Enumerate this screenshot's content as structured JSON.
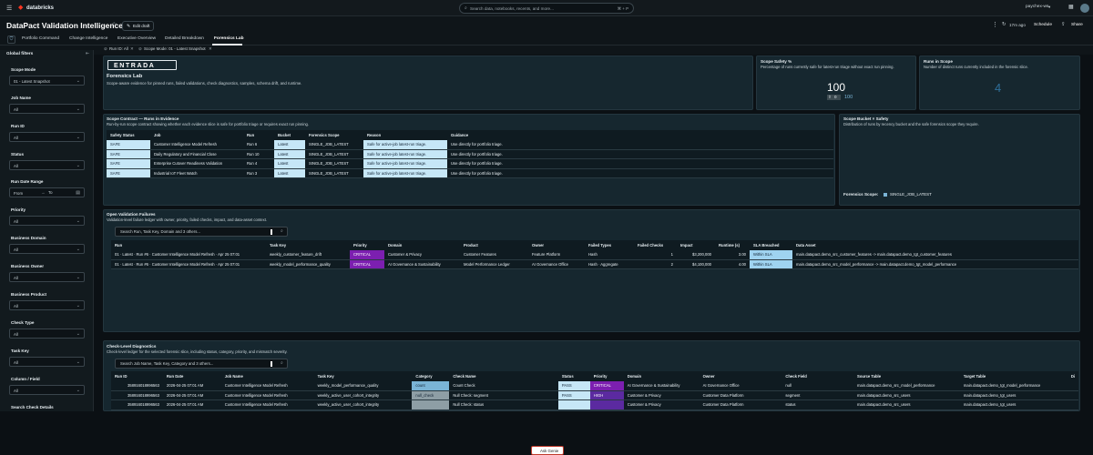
{
  "topbar": {
    "app_logo": "databricks",
    "search_placeholder": "Search data, notebooks, recents, and more...",
    "search_shortcut": "⌘ + P",
    "workspace": "paychex-ws"
  },
  "titlebar": {
    "title": "DataPact Validation Intelligence",
    "edit_draft": "Edit draft",
    "updated": "17m ago",
    "schedule": "Schedule",
    "share": "Share"
  },
  "tabs": [
    {
      "label": "Portfolio Command"
    },
    {
      "label": "Change Intelligence"
    },
    {
      "label": "Executive Overview"
    },
    {
      "label": "Detailed Breakdown"
    },
    {
      "label": "Forensics Lab"
    }
  ],
  "filter_chips": {
    "run_id": "Run ID: All",
    "scope_mode": "Scope Mode: 01 - Latest Snapshot"
  },
  "sidebar": {
    "title": "Global filters",
    "filters": [
      {
        "label": "Scope Mode",
        "value": "01 - Latest Snapshot"
      },
      {
        "label": "Job Name",
        "value": "All"
      },
      {
        "label": "Run ID",
        "value": "All"
      },
      {
        "label": "Status",
        "value": "All"
      },
      {
        "label": "Priority",
        "value": "All"
      },
      {
        "label": "Business Domain",
        "value": "All"
      },
      {
        "label": "Business Owner",
        "value": "All"
      },
      {
        "label": "Business Product",
        "value": "All"
      },
      {
        "label": "Check Type",
        "value": "All"
      },
      {
        "label": "Task Key",
        "value": "All"
      },
      {
        "label": "Column / Field",
        "value": "All"
      },
      {
        "label": "Search Check Details",
        "value": ""
      }
    ],
    "date_range": {
      "label": "Run Date Range",
      "from": "From",
      "to": "To"
    }
  },
  "header_panel": {
    "logo_text": "ENTRADA",
    "title": "Forensics Lab",
    "subtitle": "Scope-aware evidence for pinned runs, failed validations, check diagnostics, samples, schema drift, and runtime."
  },
  "scope_safety": {
    "title": "Scope Safety %",
    "subtitle": "Percentage of runs currently safe for latest-run triage without exact run pinning.",
    "value": "100",
    "delta": "0",
    "prev": "100"
  },
  "runs_in_scope": {
    "title": "Runs in Scope",
    "subtitle": "Number of distinct runs currently included in the forensic slice.",
    "value": "4"
  },
  "scope_contract": {
    "title": "Scope Contract — Runs in Evidence",
    "subtitle": "Run-by-run scope contract showing whether each evidence slice is safe for portfolio triage or requires exact run pinning.",
    "columns": [
      "Safety Status",
      "Job",
      "Run",
      "Bucket",
      "Forensics Scope",
      "Reason",
      "Guidance"
    ],
    "rows": [
      [
        "SAFE",
        "Customer Intelligence Model Refresh",
        "Run 6",
        "Latest",
        "SINGLE_JOB_LATEST",
        "Safe for active-job latest-run triage.",
        "Use directly for portfolio triage."
      ],
      [
        "SAFE",
        "Daily Regulatory and Financial Close",
        "Run 10",
        "Latest",
        "SINGLE_JOB_LATEST",
        "Safe for active-job latest-run triage.",
        "Use directly for portfolio triage."
      ],
      [
        "SAFE",
        "Enterprise Cutover Readiness Validation",
        "Run 4",
        "Latest",
        "SINGLE_JOB_LATEST",
        "Safe for active-job latest-run triage.",
        "Use directly for portfolio triage."
      ],
      [
        "SAFE",
        "Industrial IoT Fleet Watch",
        "Run 3",
        "Latest",
        "SINGLE_JOB_LATEST",
        "Safe for active-job latest-run triage.",
        "Use directly for portfolio triage."
      ]
    ]
  },
  "scope_bucket": {
    "title": "Scope Bucket × Safety",
    "subtitle": "Distribution of runs by recency bucket and the safe forensics scope they require.",
    "legend_title": "Forensics Scope:",
    "legend_item": "SINGLE_JOB_LATEST",
    "legend_color": "#7ab4d6"
  },
  "open_failures": {
    "title": "Open Validation Failures",
    "subtitle": "Validation-level failure ledger with owner, priority, failed checks, impact, and data-asset context.",
    "search_placeholder": "Search Run, Task Key, Domain and 3 others...",
    "columns": [
      "Run",
      "Task Key",
      "Priority",
      "Domain",
      "Product",
      "Owner",
      "Failed Types",
      "Failed Checks",
      "Impact",
      "Runtime (s)",
      "SLA Breached",
      "Data Asset"
    ],
    "rows": [
      [
        "01 · Latest · Run #6 · Customer Intelligence Model Refresh · Apr 25 07:01",
        "weekly_customer_feature_drift",
        "CRITICAL",
        "Customer & Privacy",
        "Customer Features",
        "Feature Platform",
        "Hash",
        "1",
        "$3,200,000",
        "3.00",
        "Within SLA",
        "main.datapact.demo_src_customer_features -> main.datapact.demo_tgt_customer_features"
      ],
      [
        "01 · Latest · Run #6 · Customer Intelligence Model Refresh · Apr 25 07:01",
        "weekly_model_performance_quality",
        "CRITICAL",
        "AI Governance & Sustainability",
        "Model Performance Ledger",
        "AI Governance Office",
        "Hash · Aggregate",
        "2",
        "$4,100,000",
        "4.00",
        "Within SLA",
        "main.datapact.demo_src_model_performance -> main.datapact.demo_tgt_model_performance"
      ]
    ]
  },
  "check_diag": {
    "title": "Check-Level Diagnostics",
    "subtitle": "Check-level ledger for the selected forensic slice, including status, category, priority, and mismatch severity.",
    "search_placeholder": "Search Job Name, Task Key, Category and 3 others...",
    "ask_genie": "Ask Genie",
    "columns": [
      "Run ID",
      "Run Date",
      "Job Name",
      "Task Key",
      "Category",
      "Check Name",
      "Status",
      "Priority",
      "Domain",
      "Owner",
      "Check Field",
      "Source Table",
      "Target Table",
      "Di"
    ],
    "rows": [
      [
        "358916018996563",
        "2026-04-25 07:01 AM",
        "Customer Intelligence Model Refresh",
        "weekly_model_performance_quality",
        "count",
        "Count Check",
        "PASS",
        "CRITICAL",
        "AI Governance & Sustainability",
        "AI Governance Office",
        "null",
        "main.datapact.demo_src_model_performance",
        "main.datapact.demo_tgt_model_performance",
        ""
      ],
      [
        "358916018996563",
        "2026-04-25 07:01 AM",
        "Customer Intelligence Model Refresh",
        "weekly_active_user_cohort_integrity",
        "null_check",
        "Null Check: segment",
        "PASS",
        "HIGH",
        "Customer & Privacy",
        "Customer Data Platform",
        "segment",
        "main.datapact.demo_src_users",
        "main.datapact.demo_tgt_users",
        ""
      ],
      [
        "358916018996563",
        "2026-04-25 07:01 AM",
        "Customer Intelligence Model Refresh",
        "weekly_active_user_cohort_integrity",
        "",
        "Null Check: status",
        "",
        "",
        "Customer & Privacy",
        "Customer Data Platform",
        "status",
        "main.datapact.demo_src_users",
        "main.datapact.demo_tgt_users",
        ""
      ]
    ]
  }
}
